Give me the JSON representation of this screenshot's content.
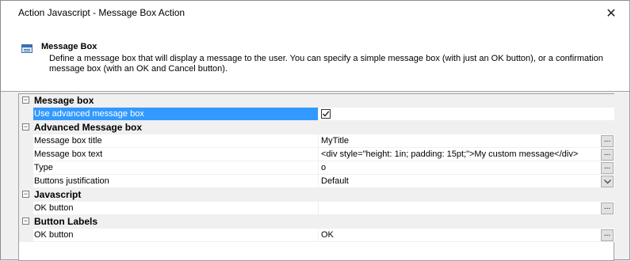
{
  "window": {
    "title": "Action Javascript - Message Box Action",
    "close_glyph": "✕"
  },
  "header": {
    "icon": "message-box-icon",
    "title": "Message Box",
    "description": "Define a message box that will display a message to the user. You can specify a simple message box (with just an OK button), or a confirmation message box (with an OK and Cancel button)."
  },
  "grid": {
    "categories": [
      {
        "label": "Message box",
        "toggle": "−",
        "properties": [
          {
            "name": "Use advanced message box",
            "value": "",
            "editor": "checkbox",
            "checked": true,
            "selected": true
          }
        ]
      },
      {
        "label": "Advanced Message box",
        "toggle": "−",
        "properties": [
          {
            "name": "Message box title",
            "value": "MyTitle",
            "editor": "ellipsis"
          },
          {
            "name": "Message box text",
            "value": "<div style=\"height: 1in; padding: 15pt;\">My custom message</div>",
            "editor": "ellipsis"
          },
          {
            "name": "Type",
            "value": "o",
            "editor": "ellipsis"
          },
          {
            "name": "Buttons justification",
            "value": "Default",
            "editor": "dropdown"
          }
        ]
      },
      {
        "label": "Javascript",
        "toggle": "−",
        "properties": [
          {
            "name": "OK button",
            "value": "",
            "editor": "ellipsis"
          }
        ]
      },
      {
        "label": "Button Labels",
        "toggle": "−",
        "properties": [
          {
            "name": "OK button",
            "value": "OK",
            "editor": "ellipsis"
          }
        ]
      }
    ],
    "ellipsis_label": "...",
    "colors": {
      "selected_bg": "#3399ff",
      "category_bg": "#f0f0f0"
    }
  }
}
